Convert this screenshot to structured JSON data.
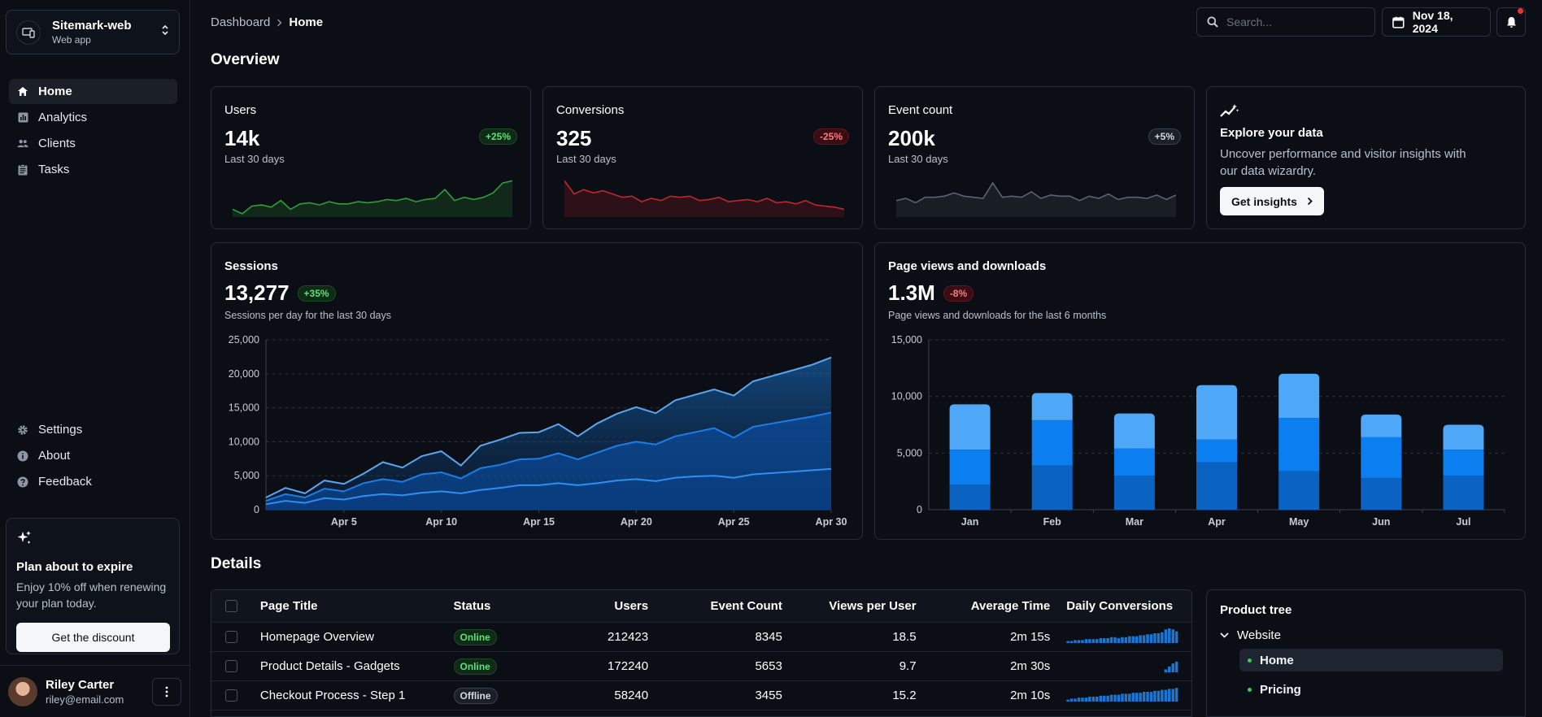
{
  "site": {
    "name": "Sitemark-web",
    "sub": "Web app"
  },
  "nav": {
    "main": [
      {
        "label": "Home",
        "icon": "home-icon",
        "active": true
      },
      {
        "label": "Analytics",
        "icon": "analytics-icon"
      },
      {
        "label": "Clients",
        "icon": "clients-icon"
      },
      {
        "label": "Tasks",
        "icon": "tasks-icon"
      }
    ],
    "secondary": [
      {
        "label": "Settings",
        "icon": "settings-icon"
      },
      {
        "label": "About",
        "icon": "info-icon"
      },
      {
        "label": "Feedback",
        "icon": "help-icon"
      }
    ]
  },
  "promo": {
    "title": "Plan about to expire",
    "text": "Enjoy 10% off when renewing your plan today.",
    "button": "Get the discount"
  },
  "user": {
    "name": "Riley Carter",
    "email": "riley@email.com"
  },
  "breadcrumb": {
    "parent": "Dashboard",
    "current": "Home"
  },
  "search": {
    "placeholder": "Search..."
  },
  "date": "Nov 18, 2024",
  "overview": {
    "title": "Overview"
  },
  "stats": [
    {
      "title": "Users",
      "value": "14k",
      "sub": "Last 30 days",
      "chip": "+25%",
      "trend": "up",
      "spark": [
        3.2,
        2.8,
        3.5,
        3.6,
        3.4,
        4.0,
        3.2,
        3.7,
        3.8,
        3.6,
        3.9,
        3.7,
        3.7,
        3.9,
        3.8,
        3.9,
        4.1,
        4.0,
        4.2,
        3.9,
        4.1,
        4.2,
        5.0,
        4.0,
        4.3,
        4.1,
        4.3,
        4.7,
        5.6,
        5.8
      ]
    },
    {
      "title": "Conversions",
      "value": "325",
      "sub": "Last 30 days",
      "chip": "-25%",
      "trend": "down",
      "spark": [
        5.8,
        4.6,
        5.0,
        4.7,
        4.9,
        4.6,
        4.3,
        4.4,
        3.9,
        4.2,
        4.0,
        4.4,
        4.3,
        4.4,
        4.0,
        4.1,
        4.3,
        3.9,
        4.0,
        4.1,
        3.9,
        4.2,
        3.8,
        3.9,
        3.7,
        4.0,
        3.6,
        3.5,
        3.4,
        3.2
      ]
    },
    {
      "title": "Event count",
      "value": "200k",
      "sub": "Last 30 days",
      "chip": "+5%",
      "trend": "neutral",
      "spark": [
        4.0,
        4.2,
        3.8,
        4.3,
        4.3,
        4.4,
        4.7,
        4.4,
        4.3,
        4.2,
        5.6,
        4.3,
        4.4,
        4.3,
        4.8,
        4.2,
        4.5,
        4.4,
        4.4,
        4.0,
        4.4,
        4.2,
        4.6,
        4.1,
        4.3,
        4.3,
        4.2,
        4.5,
        4.1,
        4.5
      ]
    }
  ],
  "explore": {
    "title": "Explore your data",
    "text": "Uncover performance and visitor insights with our data wizardry.",
    "button": "Get insights"
  },
  "sessions": {
    "title": "Sessions",
    "value": "13,277",
    "chip": "+35%",
    "sub": "Sessions per day for the last 30 days"
  },
  "pageviews": {
    "title": "Page views and downloads",
    "value": "1.3M",
    "chip": "-8%",
    "sub": "Page views and downloads for the last 6 months"
  },
  "chart_data": [
    {
      "type": "area",
      "x": [
        "Apr 1",
        "Apr 2",
        "Apr 3",
        "Apr 4",
        "Apr 5",
        "Apr 6",
        "Apr 7",
        "Apr 8",
        "Apr 9",
        "Apr 10",
        "Apr 11",
        "Apr 12",
        "Apr 13",
        "Apr 14",
        "Apr 15",
        "Apr 16",
        "Apr 17",
        "Apr 18",
        "Apr 19",
        "Apr 20",
        "Apr 21",
        "Apr 22",
        "Apr 23",
        "Apr 24",
        "Apr 25",
        "Apr 26",
        "Apr 27",
        "Apr 28",
        "Apr 29",
        "Apr 30"
      ],
      "xticks": [
        "Apr 5",
        "Apr 10",
        "Apr 15",
        "Apr 20",
        "Apr 25",
        "Apr 30"
      ],
      "ylim": [
        0,
        25000
      ],
      "yticks": [
        "0",
        "5,000",
        "10,000",
        "15,000",
        "20,000",
        "25,000"
      ],
      "grid": true,
      "series": [
        {
          "values": [
            1800,
            3200,
            2400,
            4300,
            3800,
            5300,
            7000,
            6200,
            7900,
            8600,
            6500,
            9400,
            10300,
            11300,
            11400,
            12600,
            10800,
            12700,
            14100,
            15100,
            14200,
            16100,
            16900,
            17700,
            16800,
            18900,
            19700,
            20500,
            21300,
            22400
          ]
        },
        {
          "values": [
            1300,
            2300,
            1800,
            3100,
            2700,
            3900,
            4500,
            4100,
            5200,
            5500,
            4600,
            6100,
            6600,
            7400,
            7500,
            8300,
            7400,
            8400,
            9400,
            10000,
            9600,
            10800,
            11400,
            12000,
            10600,
            12200,
            12700,
            13200,
            13700,
            14300
          ]
        },
        {
          "values": [
            800,
            1300,
            1000,
            1700,
            1500,
            2000,
            2300,
            2100,
            2500,
            2700,
            2400,
            2900,
            3200,
            3600,
            3600,
            3900,
            3600,
            3900,
            4300,
            4500,
            4200,
            4700,
            4900,
            5000,
            4700,
            5200,
            5400,
            5600,
            5800,
            6000
          ]
        }
      ]
    },
    {
      "type": "bar",
      "stacked": true,
      "categories": [
        "Jan",
        "Feb",
        "Mar",
        "Apr",
        "May",
        "Jun",
        "Jul"
      ],
      "ylim": [
        0,
        15000
      ],
      "yticks": [
        "0",
        "5,000",
        "10,000",
        "15,000"
      ],
      "grid": true,
      "series": [
        {
          "values": [
            2200,
            3900,
            3000,
            4200,
            3400,
            2800,
            3000
          ]
        },
        {
          "values": [
            3100,
            4000,
            2400,
            2000,
            4700,
            3600,
            2300
          ]
        },
        {
          "values": [
            4000,
            2400,
            3100,
            4800,
            3900,
            2000,
            2200
          ]
        }
      ]
    }
  ],
  "details": {
    "title": "Details"
  },
  "table": {
    "headers": [
      "Page Title",
      "Status",
      "Users",
      "Event Count",
      "Views per User",
      "Average Time",
      "Daily Conversions"
    ],
    "rows": [
      {
        "title": "Homepage Overview",
        "status": "Online",
        "users": "212423",
        "events": "8345",
        "views": "18.5",
        "time": "2m 15s",
        "conv": [
          2,
          2,
          3,
          3,
          3,
          4,
          4,
          4,
          4,
          5,
          5,
          5,
          6,
          6,
          5,
          6,
          6,
          7,
          7,
          7,
          8,
          8,
          9,
          9,
          10,
          10,
          11,
          14,
          15,
          14,
          12
        ]
      },
      {
        "title": "Product Details - Gadgets",
        "status": "Online",
        "users": "172240",
        "events": "5653",
        "views": "9.7",
        "time": "2m 30s",
        "conv": [
          0,
          0,
          0,
          0,
          0,
          0,
          0,
          0,
          0,
          0,
          0,
          0,
          0,
          0,
          0,
          0,
          0,
          0,
          0,
          0,
          0,
          0,
          0,
          0,
          0,
          0,
          0,
          3,
          6,
          9,
          11
        ]
      },
      {
        "title": "Checkout Process - Step 1",
        "status": "Offline",
        "users": "58240",
        "events": "3455",
        "views": "15.2",
        "time": "2m 10s",
        "conv": [
          2,
          3,
          3,
          4,
          4,
          4,
          5,
          5,
          5,
          6,
          6,
          6,
          7,
          7,
          7,
          8,
          8,
          8,
          9,
          9,
          9,
          10,
          10,
          10,
          11,
          11,
          12,
          12,
          13,
          13,
          14
        ]
      }
    ]
  },
  "tree": {
    "title": "Product tree",
    "root": "Website",
    "children": [
      "Home",
      "Pricing"
    ]
  },
  "colors": {
    "accent": "#1976d2",
    "up": "#5fe07a",
    "down": "#ff7a84",
    "bar1": "#0a62c2",
    "bar2": "#0b7ef0",
    "bar3": "#4ea8f7"
  }
}
